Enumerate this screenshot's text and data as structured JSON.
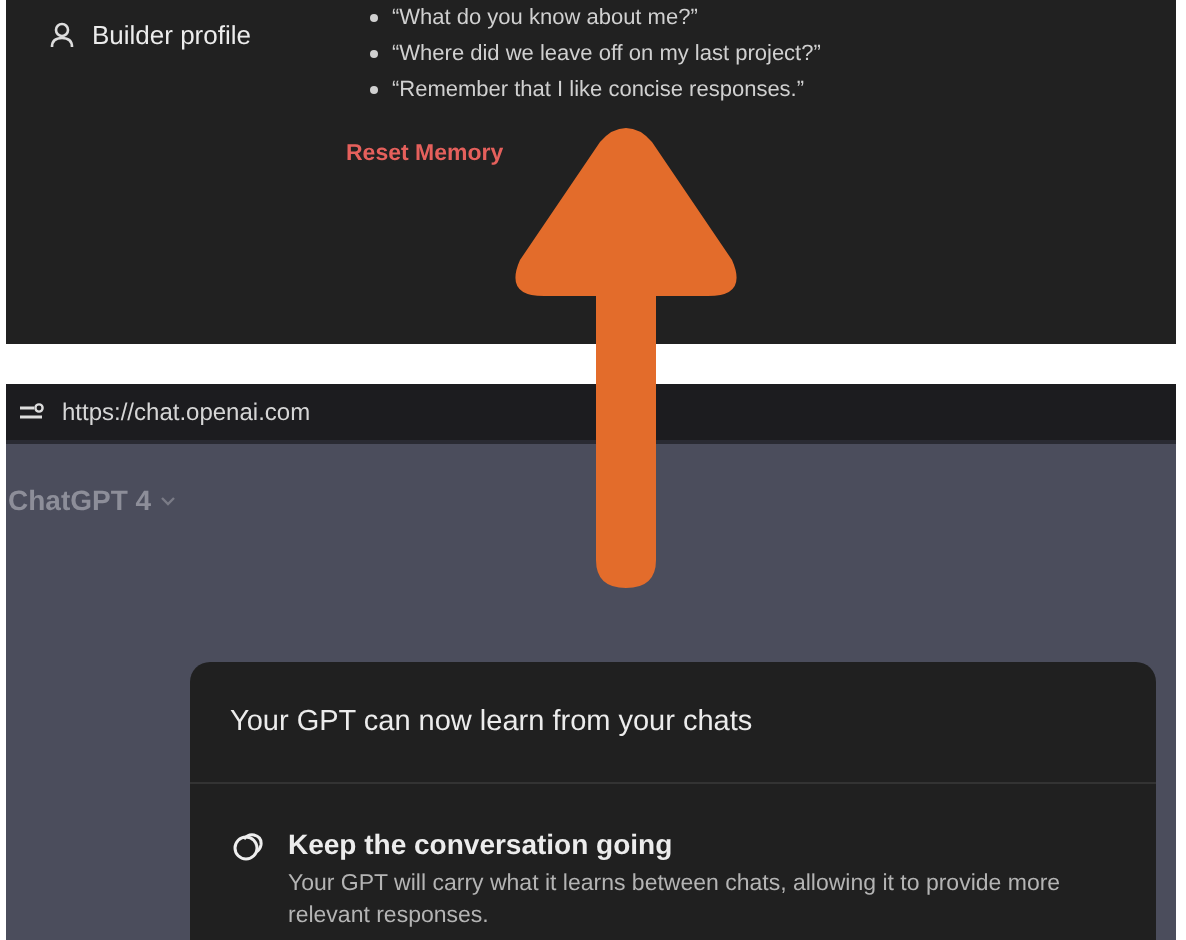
{
  "settings_panel": {
    "sidebar_item": {
      "label": "Builder profile"
    },
    "examples": [
      "“What do you know about me?”",
      "“Where did we leave off on my last project?”",
      "“Remember that I like concise responses.”"
    ],
    "reset_link": "Reset Memory"
  },
  "browser": {
    "url": "https://chat.openai.com",
    "model_selector": "ChatGPT 4",
    "dialog": {
      "title": "Your GPT can now learn from your chats",
      "features": [
        {
          "title": "Keep the conversation going",
          "description": "Your GPT will carry what it learns between chats, allowing it to provide more relevant responses."
        }
      ]
    }
  }
}
